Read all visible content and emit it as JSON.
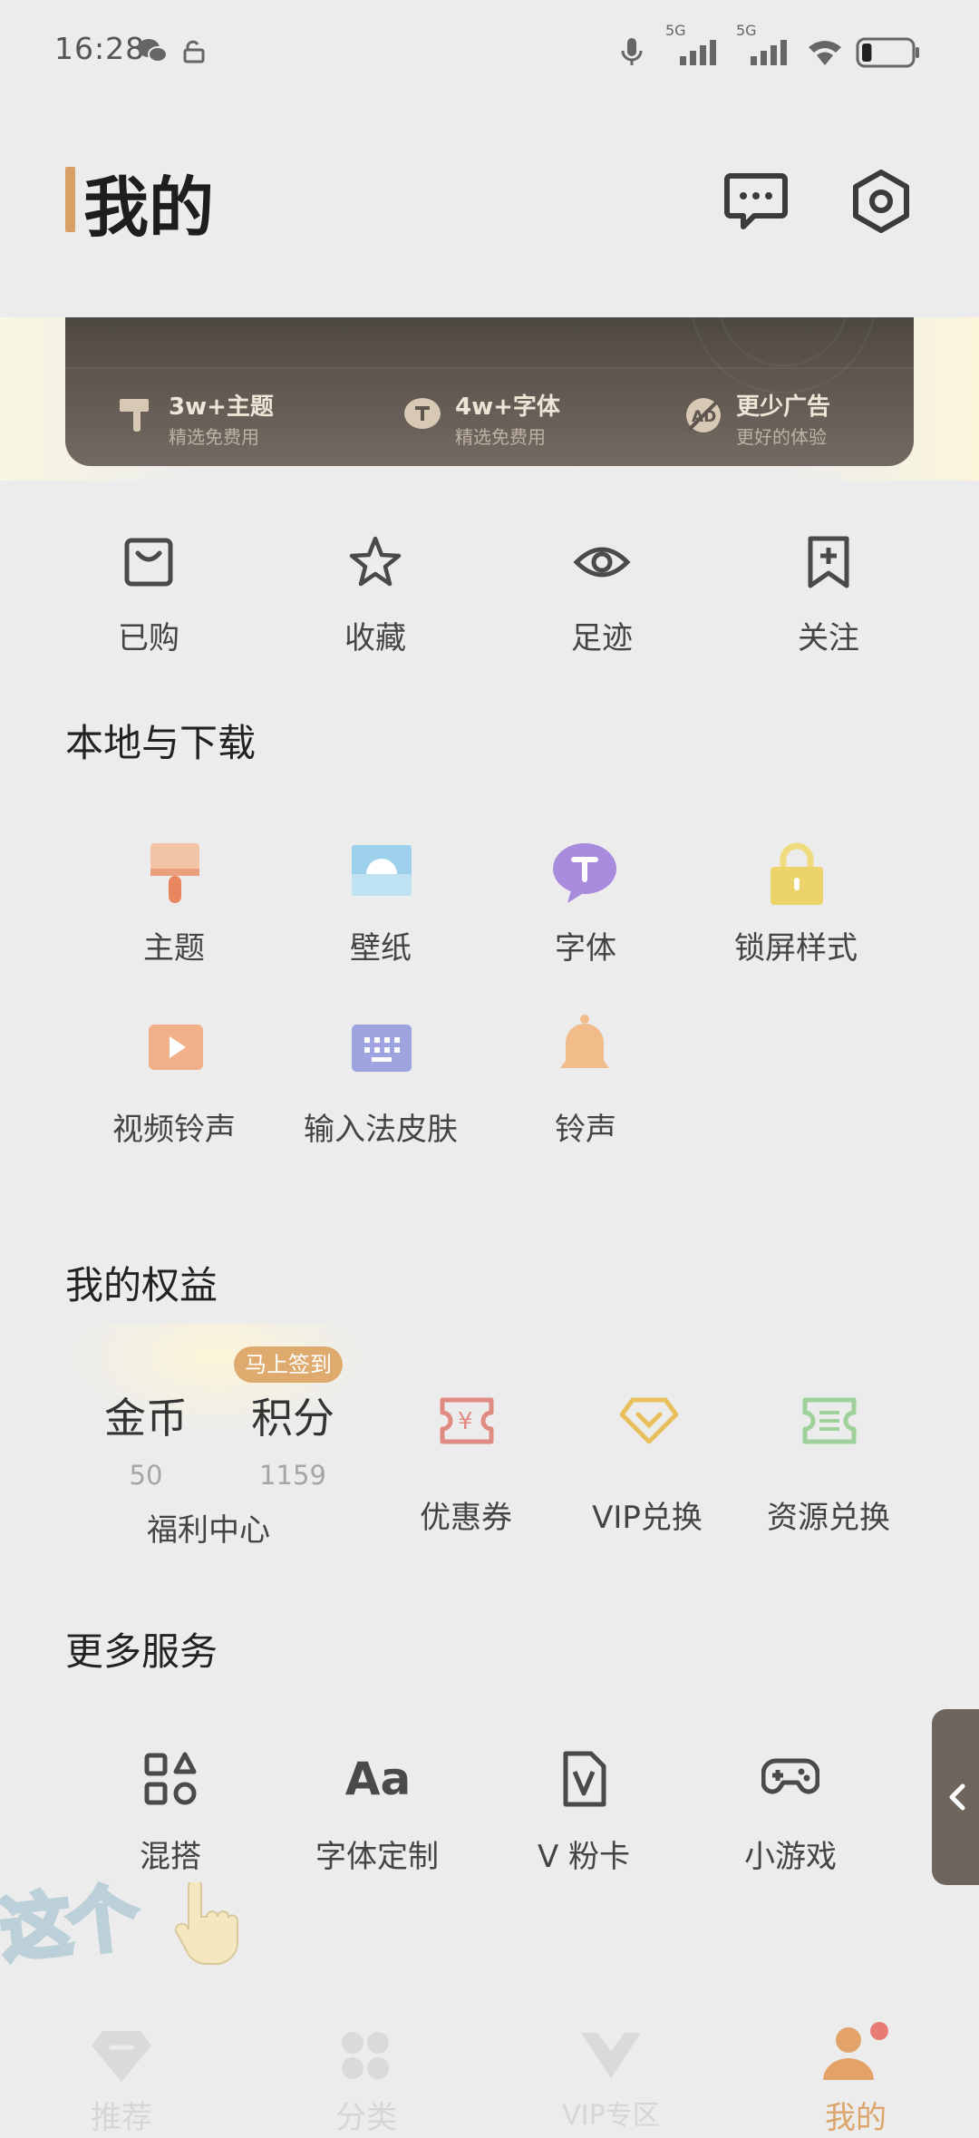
{
  "status_bar": {
    "time": "16:28",
    "icons": [
      "wechat-icon",
      "unlock-icon",
      "mic-icon",
      "signal-5g-icon",
      "signal-5g-icon",
      "wifi-icon",
      "battery-icon"
    ],
    "net1": "5G",
    "net2": "5G",
    "battery_level": 0.2
  },
  "header": {
    "title": "我的",
    "accent_color": "#d9a066",
    "icons": [
      "message-icon",
      "settings-icon"
    ]
  },
  "vip_banner": {
    "perks": [
      {
        "title": "3w+主题",
        "subtitle": "精选免费用",
        "icon": "paint-brush-icon"
      },
      {
        "title": "4w+字体",
        "subtitle": "精选免费用",
        "icon": "font-icon"
      },
      {
        "title": "更少广告",
        "subtitle": "更好的体验",
        "icon": "no-ad-icon"
      }
    ]
  },
  "quick_actions": [
    {
      "label": "已购",
      "icon": "purchased-bag-icon"
    },
    {
      "label": "收藏",
      "icon": "star-icon"
    },
    {
      "label": "足迹",
      "icon": "eye-icon"
    },
    {
      "label": "关注",
      "icon": "bookmark-plus-icon"
    }
  ],
  "local_section": {
    "title": "本地与下载",
    "items": [
      {
        "label": "主题",
        "icon": "brush-icon",
        "color": "#e8a07e"
      },
      {
        "label": "壁纸",
        "icon": "wallpaper-icon",
        "color": "#8fc3dd"
      },
      {
        "label": "字体",
        "icon": "font-bubble-icon",
        "color": "#a58bd6"
      },
      {
        "label": "锁屏样式",
        "icon": "lock-icon",
        "color": "#ecd36a"
      },
      {
        "label": "视频铃声",
        "icon": "video-play-icon",
        "color": "#eba883"
      },
      {
        "label": "输入法皮肤",
        "icon": "keyboard-icon",
        "color": "#9aa3dc"
      },
      {
        "label": "铃声",
        "icon": "bell-icon",
        "color": "#ebb486"
      }
    ]
  },
  "rights_section": {
    "title": "我的权益",
    "coins": {
      "label": "金币",
      "value": "50"
    },
    "points": {
      "label": "积分",
      "value": "1159"
    },
    "checkin_badge": "马上签到",
    "welfare_label": "福利中心",
    "items": [
      {
        "label": "优惠券",
        "icon": "coupon-icon",
        "color": "#e18a82"
      },
      {
        "label": "VIP兑换",
        "icon": "vip-diamond-icon",
        "color": "#e8bf5a"
      },
      {
        "label": "资源兑换",
        "icon": "ticket-icon",
        "color": "#9fd29a"
      }
    ]
  },
  "more_section": {
    "title": "更多服务",
    "items": [
      {
        "label": "混搭",
        "icon": "mix-shapes-icon"
      },
      {
        "label": "字体定制",
        "icon": "font-aa-icon",
        "glyph": "Aa"
      },
      {
        "label": "V 粉卡",
        "icon": "v-card-icon",
        "glyph": "V"
      },
      {
        "label": "小游戏",
        "icon": "gamepad-icon"
      }
    ]
  },
  "side_tab": {
    "icon": "chevron-left-icon"
  },
  "doodle_text": "这个",
  "bottom_nav": [
    {
      "label": "推荐",
      "icon": "diamond-recommend-icon",
      "active": false
    },
    {
      "label": "分类",
      "icon": "category-grid-icon",
      "active": false
    },
    {
      "label": "VIP专区",
      "icon": "vip-crown-icon",
      "active": false
    },
    {
      "label": "我的",
      "icon": "profile-icon",
      "active": true
    }
  ]
}
